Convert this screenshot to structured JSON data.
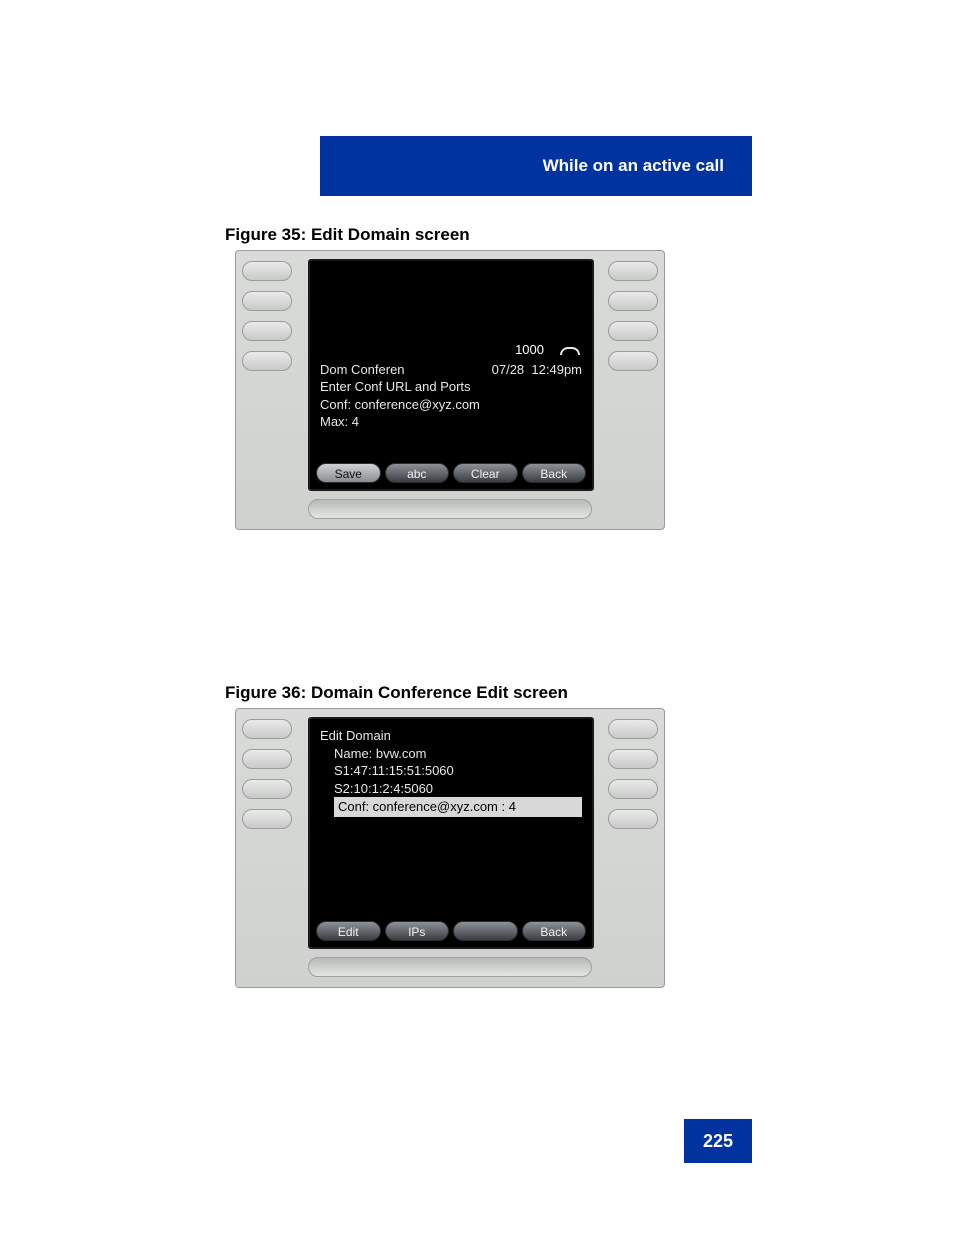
{
  "header": {
    "title": "While on an active call"
  },
  "captions": {
    "fig35": "Figure 35: Edit Domain screen",
    "fig36": "Figure 36: Domain Conference Edit screen"
  },
  "screen1": {
    "status_number": "1000",
    "date": "07/28",
    "time": "12:49pm",
    "line1_left": "Dom Conferen",
    "line2": "Enter Conf URL and Ports",
    "line3": "Conf: conference@xyz.com",
    "line4": "Max:  4",
    "softkeys": {
      "k1": "Save",
      "k2": "abc",
      "k3": "Clear",
      "k4": "Back"
    }
  },
  "screen2": {
    "title": "Edit Domain",
    "line1": "Name: bvw.com",
    "line2": "S1:47:11:15:51:5060",
    "line3": "S2:10:1:2:4:5060",
    "line4_hl": "Conf: conference@xyz.com : 4",
    "softkeys": {
      "k1": "Edit",
      "k2": "IPs",
      "k3": "",
      "k4": "Back"
    }
  },
  "page_number": "225"
}
